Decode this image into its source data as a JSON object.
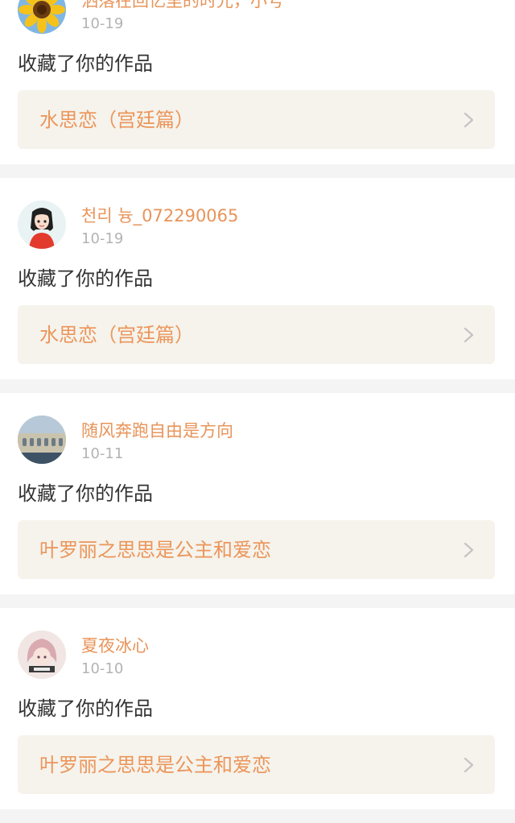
{
  "notifications": [
    {
      "username": "洒落在回忆里的时光，小号",
      "date": "10-19",
      "action": "收藏了你的作品",
      "work_title": "水思恋（宫廷篇）",
      "avatar_icon": "sunflower-avatar"
    },
    {
      "username": "천리 늉_072290065",
      "date": "10-19",
      "action": "收藏了你的作品",
      "work_title": "水思恋（宫廷篇）",
      "avatar_icon": "anime-girl-avatar"
    },
    {
      "username": "随风奔跑自由是方向",
      "date": "10-11",
      "action": "收藏了你的作品",
      "work_title": "叶罗丽之思思是公主和爱恋",
      "avatar_icon": "building-photo-avatar"
    },
    {
      "username": "夏夜冰心",
      "date": "10-10",
      "action": "收藏了你的作品",
      "work_title": "叶罗丽之思思是公主和爱恋",
      "avatar_icon": "anime-character-avatar"
    }
  ],
  "colors": {
    "username": "#e8945a",
    "work_title": "#ec955a",
    "work_background": "#f5f3ec",
    "date": "#b3b3b3",
    "separator": "#f4f4f4"
  }
}
